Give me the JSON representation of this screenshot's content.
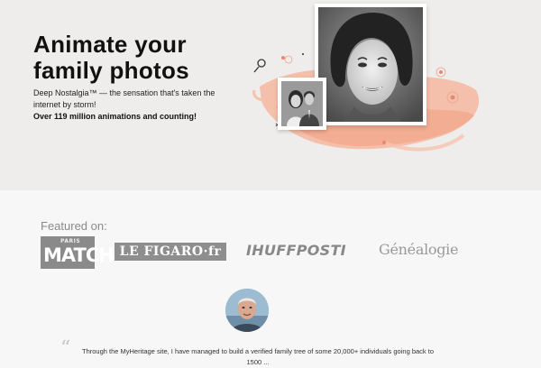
{
  "hero": {
    "title_line1": "Animate your",
    "title_line2": "family photos",
    "description": "Deep Nostalgia™ — the sensation that's taken the internet by storm!",
    "stat": "Over 119 million animations and counting!"
  },
  "featured": {
    "label": "Featured on:",
    "logos": {
      "paris_match_small": "PARIS",
      "paris_match_big": "MATCH",
      "figaro": "LE FIGARO·fr",
      "huffpost": "IHUFFPOSTI",
      "genealogie": "Généalogie"
    }
  },
  "testimonial": {
    "quote_mark": "“",
    "text": "Through the MyHeritage site, I have managed to build a verified family tree of some 20,000+ individuals going back to 1500 ..."
  },
  "colors": {
    "hero_bg": "#efedec",
    "page_bg": "#f7f7f7",
    "accent_brush": "#f4a58a"
  }
}
